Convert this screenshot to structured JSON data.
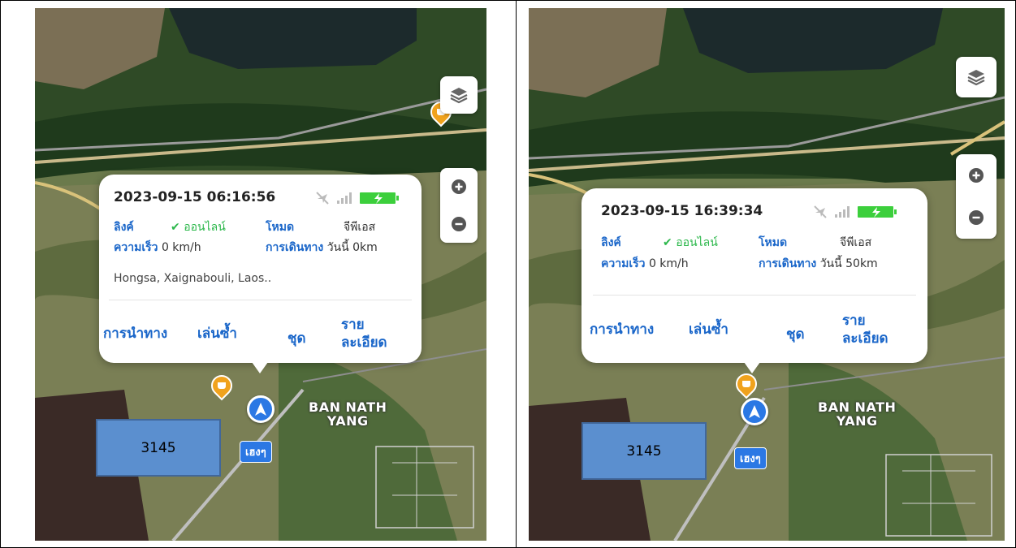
{
  "panels": [
    {
      "timestamp": "2023-09-15 06:16:56",
      "link_label": "ลิงค์",
      "status_label": "ออนไลน์",
      "mode_label": "โหมด",
      "mode_value": "จีพีเอส",
      "speed_label": "ความเร็ว",
      "speed_value": "0 km/h",
      "trip_label": "การเดินทาง",
      "trip_value": "วันนี้ 0km",
      "address": "Hongsa, Xaignabouli, Laos..",
      "actions": {
        "navigate": "การนำทาง",
        "replay": "เล่นซ้ำ",
        "set": "ชุด",
        "details_line1": "ราย",
        "details_line2": "ละเอียด"
      },
      "vehicle_id": "3145",
      "vehicle_tag": "เฮงๆ",
      "place_label_line1": "BAN NATH",
      "place_label_line2": "YANG"
    },
    {
      "timestamp": "2023-09-15 16:39:34",
      "link_label": "ลิงค์",
      "status_label": "ออนไลน์",
      "mode_label": "โหมด",
      "mode_value": "จีพีเอส",
      "speed_label": "ความเร็ว",
      "speed_value": "0 km/h",
      "trip_label": "การเดินทาง",
      "trip_value": "วันนี้ 50km",
      "address": "",
      "actions": {
        "navigate": "การนำทาง",
        "replay": "เล่นซ้ำ",
        "set": "ชุด",
        "details_line1": "ราย",
        "details_line2": "ละเอียด"
      },
      "vehicle_id": "3145",
      "vehicle_tag": "เฮงๆ",
      "place_label_line1": "BAN NATH",
      "place_label_line2": "YANG"
    }
  ],
  "icons": {
    "layers": "layers-icon",
    "zoom_in": "zoom-in-icon",
    "zoom_out": "zoom-out-icon",
    "gps_off": "gps-off-icon",
    "signal": "signal-icon",
    "battery": "battery-charging-icon",
    "check": "check-icon",
    "navigation_arrow": "navigation-arrow-icon",
    "cafe_marker": "cafe-marker-icon"
  },
  "colors": {
    "accent_blue": "#1a66c9",
    "online_green": "#2db84c",
    "battery_green": "#3ccf3c",
    "vehicle_box": "#5b8fcf",
    "marker_orange": "#f0a21d"
  }
}
